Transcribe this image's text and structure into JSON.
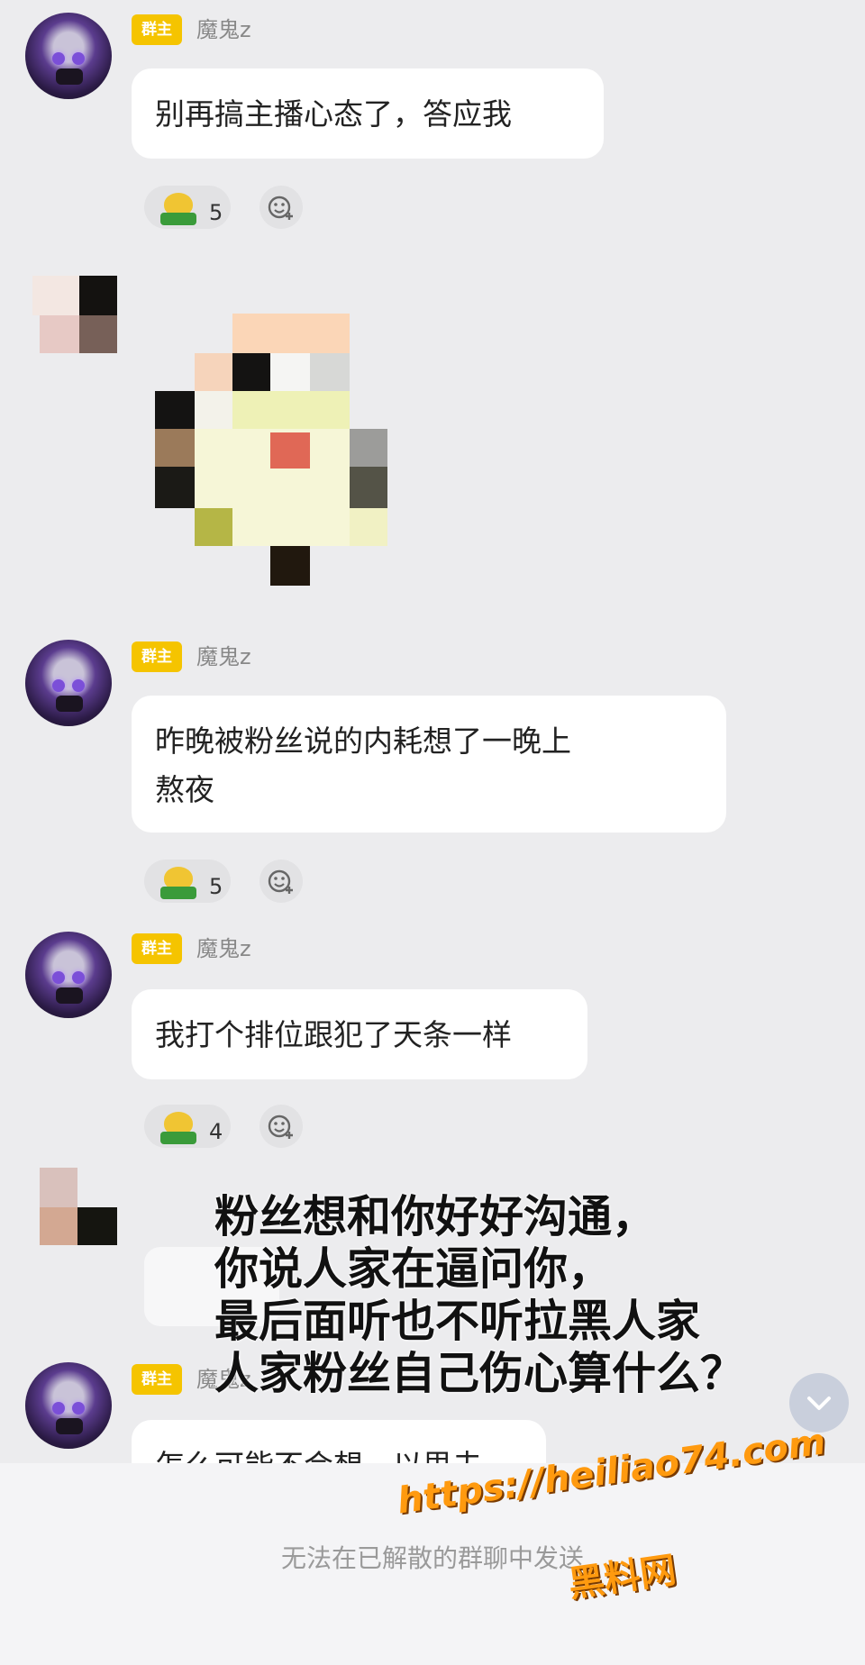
{
  "messages": [
    {
      "role_badge": "群主",
      "nickname": "魔鬼z",
      "text": "别再搞主播心态了，答应我",
      "reaction_count": "5"
    },
    {
      "role_badge": "群主",
      "nickname": "魔鬼z",
      "text": "昨晚被粉丝说的内耗想了一晚上\n熬夜",
      "reaction_count": "5"
    },
    {
      "role_badge": "群主",
      "nickname": "魔鬼z",
      "text": "我打个排位跟犯了天条一样",
      "reaction_count": "4"
    },
    {
      "role_badge": "群主",
      "nickname": "魔鬼z",
      "text": "怎么可能不会想，以思夫",
      "reaction_count": ""
    }
  ],
  "overlay_caption": [
    "粉丝想和你好好沟通，",
    "你说人家在逼问你，",
    "最后面听也不听拉黑人家",
    "人家粉丝自己伤心算什么？"
  ],
  "bottom_notice": "无法在已解散的群聊中发送",
  "watermark": {
    "url": "https://heiliao74.com",
    "label": "黑料网"
  },
  "colors": {
    "badge": "#f5c400",
    "background": "#ececee",
    "watermark": "#ff9a0f"
  },
  "icons": {
    "reaction": "emoji-reaction-icon",
    "add_reaction": "add-reaction-icon",
    "scroll": "chevron-down-icon"
  }
}
